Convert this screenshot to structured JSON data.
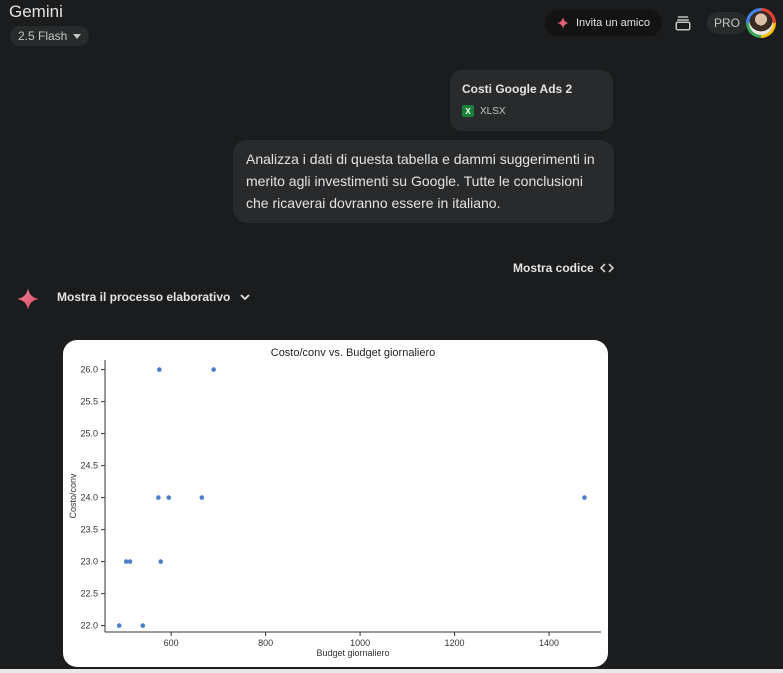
{
  "header": {
    "app_title": "Gemini",
    "model_label": "2.5 Flash",
    "invite_label": "Invita un amico",
    "pro_label": "PRO",
    "icons": [
      "spark-icon",
      "history-icon",
      "caret-down-icon",
      "avatar"
    ]
  },
  "attachment": {
    "name": "Costi Google Ads 2",
    "type_label": "XLSX",
    "icon": "spreadsheet-icon",
    "icon_letter": "X"
  },
  "user_message": {
    "text": "Analizza i dati di questa tabella e dammi suggerimenti in merito agli investimenti su Google. Tutte le conclusioni che ricaverai dovranno essere in italiano."
  },
  "response": {
    "show_code_label": "Mostra codice",
    "thinking_label": "Mostra il processo elaborativo"
  },
  "colors": {
    "background": "#1b1c1d",
    "bubble": "#282a2c",
    "accent_spark": "#e8607a",
    "point": "#4a7fc8"
  },
  "chart_data": {
    "type": "scatter",
    "title": "Costo/conv vs. Budget giornaliero",
    "xlabel": "Budget giornaliero",
    "ylabel": "Costo/conv",
    "xlim": [
      460,
      1510
    ],
    "ylim": [
      21.9,
      26.15
    ],
    "xticks": [
      600,
      800,
      1000,
      1200,
      1400
    ],
    "yticks": [
      22.0,
      22.5,
      23.0,
      23.5,
      24.0,
      24.5,
      25.0,
      25.5,
      26.0
    ],
    "xtick_labels": [
      "600",
      "800",
      "1000",
      "1200",
      "1400"
    ],
    "ytick_labels": [
      "22.0",
      "22.5",
      "23.0",
      "23.5",
      "24.0",
      "24.5",
      "25.0",
      "25.5",
      "26.0"
    ],
    "grid": false,
    "points": [
      {
        "x": 490,
        "y": 22.0
      },
      {
        "x": 540,
        "y": 22.0
      },
      {
        "x": 505,
        "y": 23.0
      },
      {
        "x": 513,
        "y": 23.0
      },
      {
        "x": 578,
        "y": 23.0
      },
      {
        "x": 573,
        "y": 24.0
      },
      {
        "x": 595,
        "y": 24.0
      },
      {
        "x": 665,
        "y": 24.0
      },
      {
        "x": 1475,
        "y": 24.0
      },
      {
        "x": 575,
        "y": 26.0
      },
      {
        "x": 690,
        "y": 26.0
      }
    ]
  }
}
